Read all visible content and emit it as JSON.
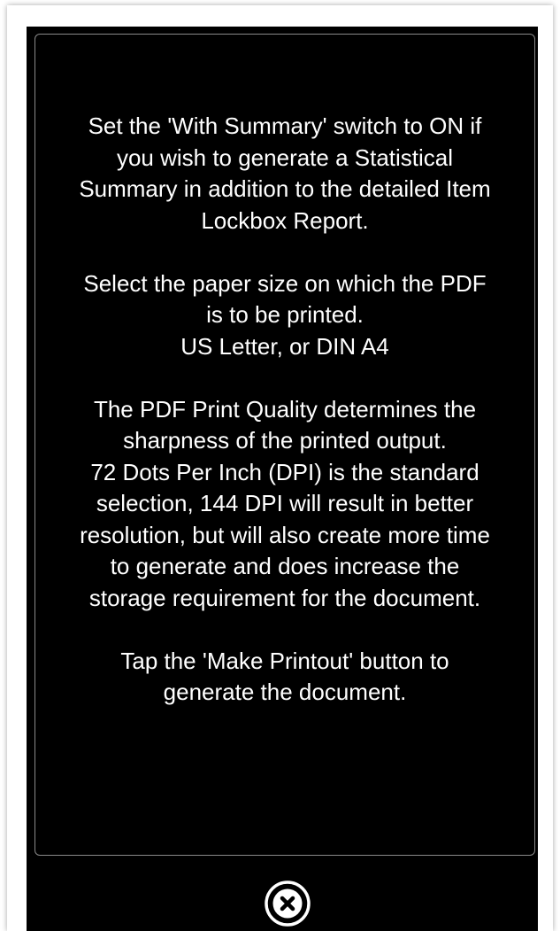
{
  "help": {
    "paragraphs": [
      "Set the 'With Summary' switch to ON if\nyou wish to generate a Statistical\nSummary in addition to the detailed Item\nLockbox Report.",
      "Select the paper size on which the PDF\nis to be printed.\nUS Letter, or DIN A4",
      "The PDF Print Quality determines the\nsharpness of the printed output.\n72 Dots Per Inch (DPI) is the standard\nselection, 144 DPI will result in better\nresolution, but will also create more time\nto generate and does increase the\nstorage requirement for the document.",
      "Tap the 'Make Printout' button to\ngenerate the document."
    ]
  },
  "close_button": {
    "icon": "close-circle-icon"
  },
  "colors": {
    "background": "#000000",
    "text": "#ffffff",
    "panel_border": "#8a8a8a"
  }
}
